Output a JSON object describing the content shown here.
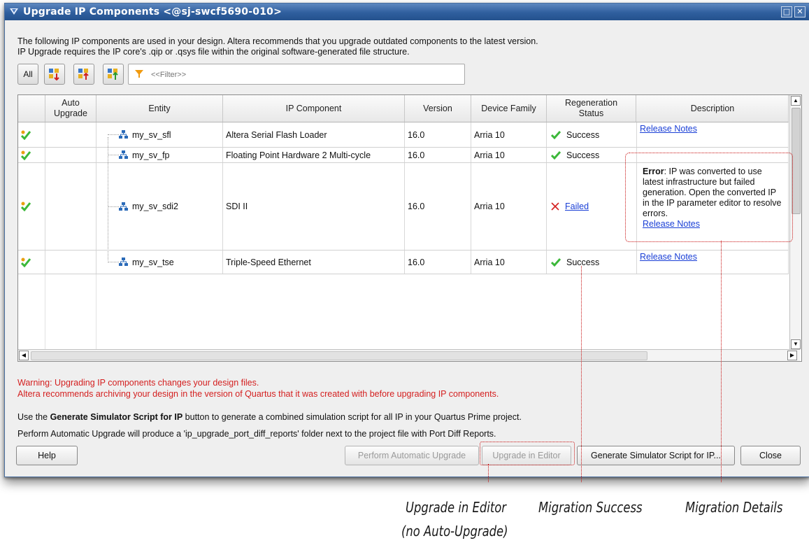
{
  "window": {
    "title": "Upgrade IP Components <@sj-swcf5690-010>",
    "maximize_icon": "□",
    "close_icon": "✕"
  },
  "intro": {
    "line1": "The following IP components are used in your design. Altera recommends that you upgrade outdated components to the latest version.",
    "line2": "IP Upgrade requires the IP core's .qip or .qsys file within the original software-generated file structure."
  },
  "toolbar": {
    "all_label": "All",
    "filter_placeholder": "<<Filter>>"
  },
  "table": {
    "columns": [
      "",
      "Auto Upgrade",
      "Entity",
      "IP Component",
      "Version",
      "Device Family",
      "Regeneration Status",
      "Description"
    ],
    "rows": [
      {
        "entity": "my_sv_sfl",
        "ip_component": "Altera Serial Flash Loader",
        "version": "16.0",
        "device_family": "Arria 10",
        "status": "Success",
        "status_ok": true,
        "description_error": "",
        "description_error_label": "",
        "release_notes": "Release Notes"
      },
      {
        "entity": "my_sv_fp",
        "ip_component": "Floating Point Hardware 2 Multi-cycle",
        "version": "16.0",
        "device_family": "Arria 10",
        "status": "Success",
        "status_ok": true,
        "description_error": "",
        "description_error_label": "",
        "release_notes": ""
      },
      {
        "entity": "my_sv_sdi2",
        "ip_component": "SDI II",
        "version": "16.0",
        "device_family": "Arria 10",
        "status": "Failed",
        "status_ok": false,
        "description_error_label": "Error",
        "description_error": ": IP was converted to use latest infrastructure but failed generation. Open the converted IP in the IP parameter editor to resolve errors.",
        "release_notes": "Release Notes"
      },
      {
        "entity": "my_sv_tse",
        "ip_component": "Triple-Speed Ethernet",
        "version": "16.0",
        "device_family": "Arria 10",
        "status": "Success",
        "status_ok": true,
        "description_error": "",
        "description_error_label": "",
        "release_notes": "Release Notes"
      }
    ]
  },
  "warning": {
    "line1": "Warning: Upgrading IP components changes your design files.",
    "line2": "Altera recommends archiving your design in the version of Quartus that it was created with before upgrading IP components."
  },
  "info": {
    "line1_pre": "Use the ",
    "line1_bold": "Generate Simulator Script for IP",
    "line1_post": " button to generate a combined simulation script for all IP in your Quartus Prime project.",
    "line2": "Perform Automatic Upgrade will produce a 'ip_upgrade_port_diff_reports' folder next to the project file with Port Diff Reports."
  },
  "buttons": {
    "help": "Help",
    "auto_upgrade": "Perform Automatic Upgrade",
    "upgrade_editor": "Upgrade in Editor",
    "gen_sim": "Generate Simulator Script for IP...",
    "close": "Close"
  },
  "captions": {
    "upgrade_editor_1": "Upgrade in Editor",
    "upgrade_editor_2": "(no Auto-Upgrade)",
    "migration_success": "Migration Success",
    "migration_details": "Migration Details"
  },
  "colors": {
    "titlebar": "#2f5f9e",
    "warning": "#d42020",
    "link": "#1a3fd6",
    "success": "#3cb83a",
    "failed": "#d42020",
    "callout": "#c81010"
  }
}
